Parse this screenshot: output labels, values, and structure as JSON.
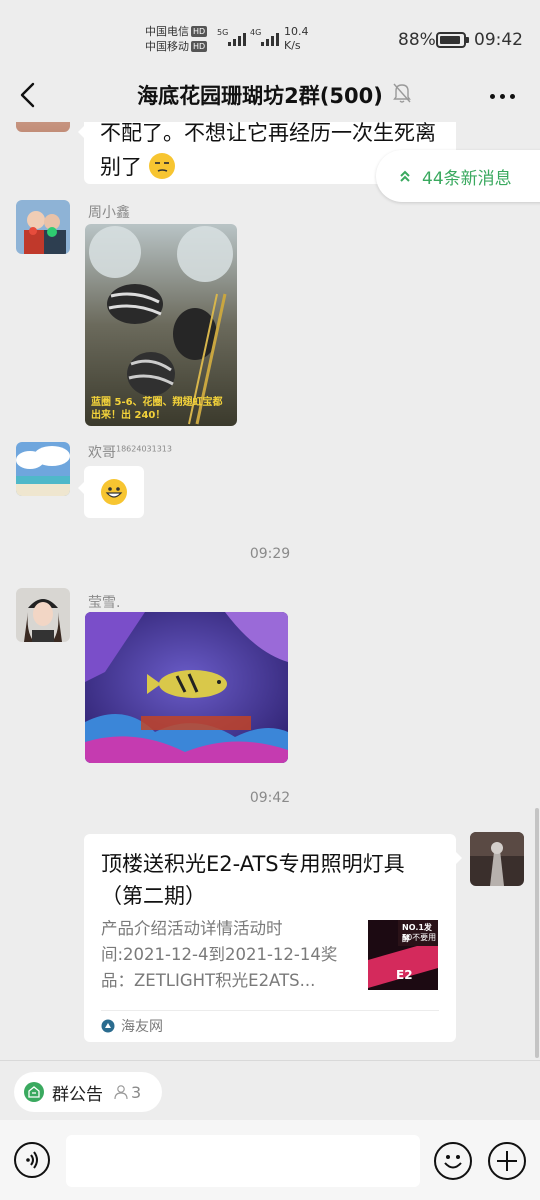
{
  "status_bar": {
    "carrier1": "中国电信",
    "carrier2": "中国移动",
    "hd": "HD",
    "net1": "5G",
    "net2": "4G",
    "speed_value": "10.4",
    "speed_unit": "K/s",
    "battery_pct": "88%",
    "battery_level": 0.88,
    "time": "09:42"
  },
  "nav": {
    "title": "海底花园珊瑚坊2群(500)",
    "back_icon": "chevron-left-icon",
    "mute_icon": "bell-off-icon",
    "more_icon": "more-dots-icon"
  },
  "new_messages": "44条新消息",
  "messages": {
    "m0_text": "不配了。不想让它再经历一次生死离别了",
    "m1_sender": "周小鑫",
    "m1_image_caption": "蓝圈 5-6、花圈、翔翅虹宝都出来！出 240！",
    "m2_sender": "欢哥",
    "m2_sender_suffix": "18624031313",
    "t1": "09:29",
    "m3_sender": "莹雪.",
    "t2": "09:42",
    "card_title": "顶楼送积光E2-ATS专用照明灯具（第二期）",
    "card_desc": "产品介绍活动详情活动时间:2021-12-4到2021-12-14奖品：ZETLIGHT积光E2ATS...",
    "card_source": "海友网",
    "card_thumb_text1": "NO.1发酵",
    "card_thumb_text2": "50不要用",
    "card_thumb_text3": "E2"
  },
  "bottom": {
    "notice_label": "群公告",
    "notice_count": "3"
  },
  "colors": {
    "accent_green": "#3aa95f",
    "background": "#ededed"
  }
}
